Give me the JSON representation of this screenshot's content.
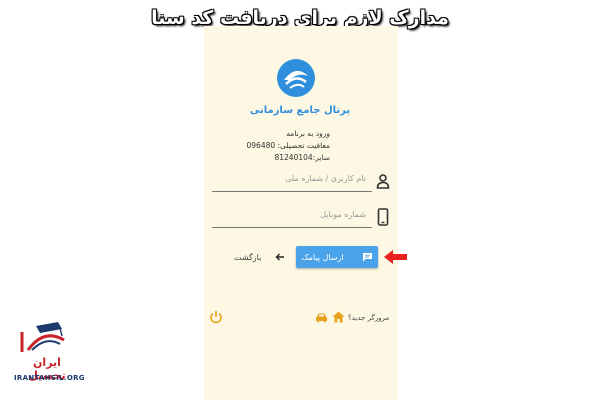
{
  "headline": "مدارک لازم برای دریافت کد سنا",
  "portal": {
    "title": "پرتال جامع سازمانی",
    "info_line1": "ورود به برنامه",
    "info_line2": "معافیت تحصیلی: 096480",
    "info_line3": "سایر:81240104"
  },
  "form": {
    "username_placeholder": "نام کاربری / شماره ملی",
    "mobile_placeholder": "شماره موبایل",
    "send_label": "ارسال پیامک",
    "back_label": "بازگشت"
  },
  "footer": {
    "new_browser": "مرورگر جدید؟"
  },
  "brand": {
    "name": "ایران تحصیل",
    "url": "IRANTAHSIL.ORG"
  },
  "colors": {
    "panel_bg": "#fdf8e3",
    "accent_blue": "#4aa3e8",
    "pointer_red": "#e8221c",
    "power_orange": "#e6a11a"
  }
}
